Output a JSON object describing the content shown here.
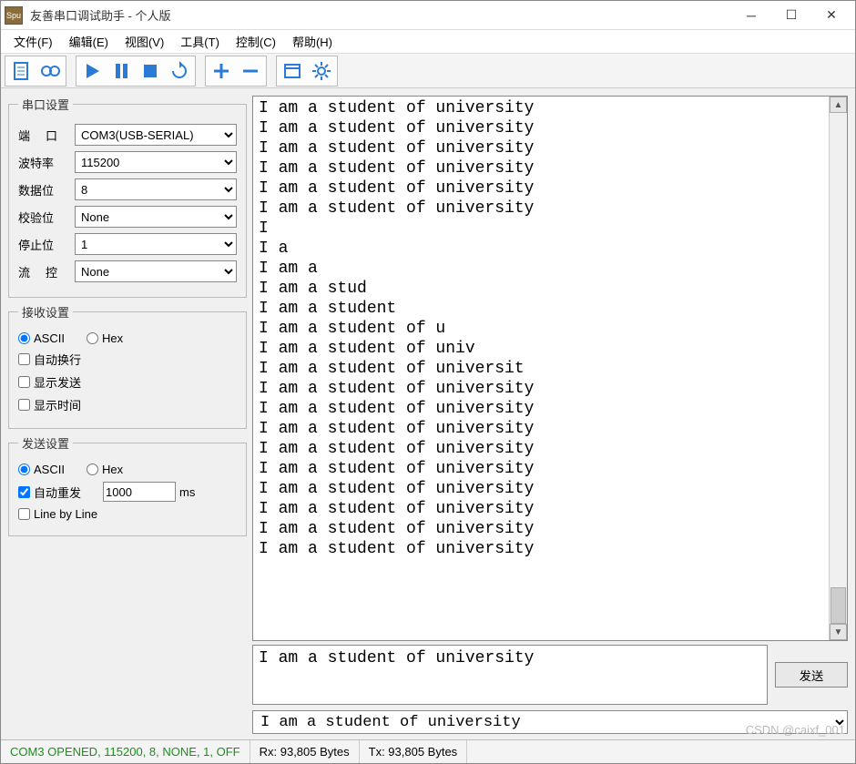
{
  "window": {
    "title": "友善串口调试助手 - 个人版",
    "app_icon_text": "Spu"
  },
  "menus": {
    "file": "文件(F)",
    "edit": "编辑(E)",
    "view": "视图(V)",
    "tools": "工具(T)",
    "control": "控制(C)",
    "help": "帮助(H)"
  },
  "serial_settings": {
    "legend": "串口设置",
    "port_label": "端　口",
    "port_value": "COM3(USB-SERIAL)",
    "baud_label": "波特率",
    "baud_value": "115200",
    "data_label": "数据位",
    "data_value": "8",
    "parity_label": "校验位",
    "parity_value": "None",
    "stop_label": "停止位",
    "stop_value": "1",
    "flow_label": "流　控",
    "flow_value": "None"
  },
  "recv_settings": {
    "legend": "接收设置",
    "ascii": "ASCII",
    "hex": "Hex",
    "autowrap": "自动换行",
    "showsend": "显示发送",
    "showtime": "显示时间"
  },
  "send_settings": {
    "legend": "发送设置",
    "ascii": "ASCII",
    "hex": "Hex",
    "autoresend": "自动重发",
    "interval": "1000",
    "interval_unit": "ms",
    "linebyline": "Line by Line"
  },
  "rx": {
    "lines": [
      "I am a student of university",
      "I am a student of university",
      "I am a student of university",
      "I am a student of university",
      "I am a student of university",
      "I am a student of university",
      "I",
      "I a",
      "I am a",
      "I am a stud",
      "I am a student",
      "I am a student of u",
      "I am a student of univ",
      "I am a student of universit",
      "I am a student of university",
      "I am a student of university",
      "I am a student of university",
      "I am a student of university",
      "I am a student of university",
      "I am a student of university",
      "I am a student of university",
      "I am a student of university",
      "I am a student of university"
    ]
  },
  "tx": {
    "input": "I am a student of university",
    "send_label": "发送",
    "history": "I am a student of university"
  },
  "status": {
    "conn": "COM3 OPENED, 115200, 8, NONE, 1, OFF",
    "rx": "Rx: 93,805 Bytes",
    "tx": "Tx: 93,805 Bytes"
  },
  "watermark": "CSDN @caixf_001"
}
